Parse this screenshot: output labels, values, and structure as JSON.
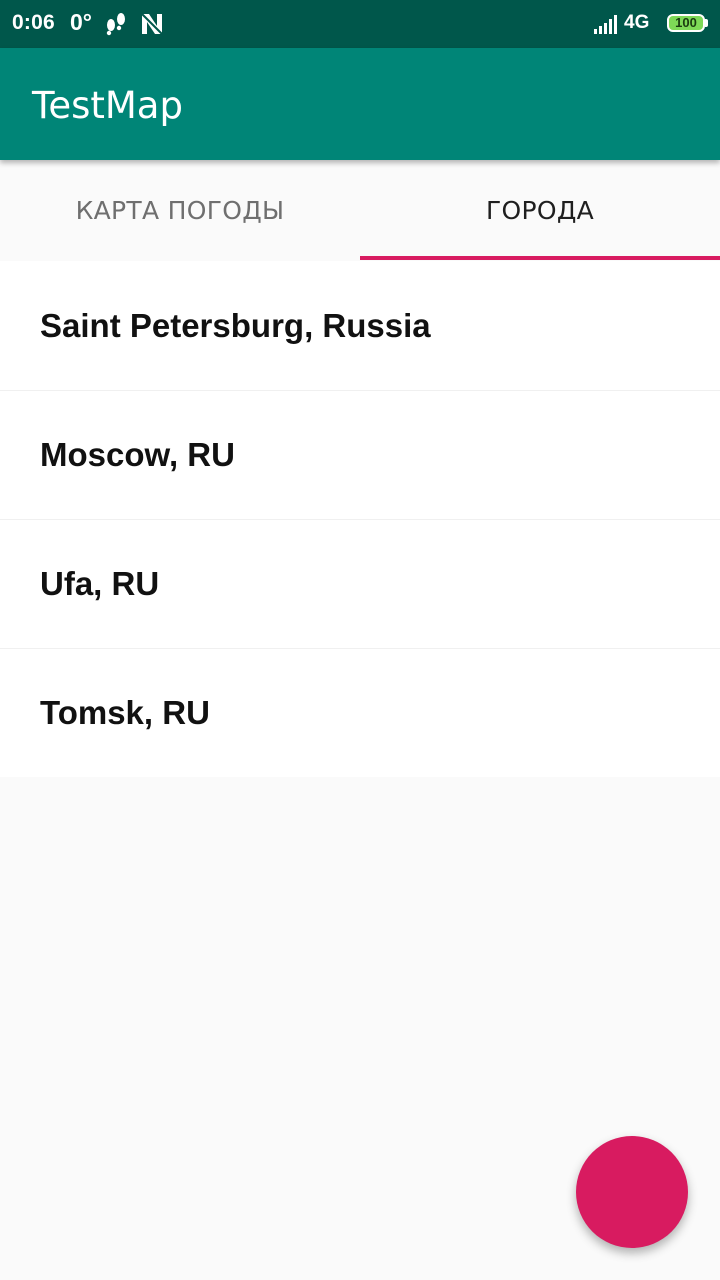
{
  "status_bar": {
    "time": "0:06",
    "temperature": "0°",
    "network": "4G",
    "battery": "100",
    "icons": [
      "footsteps-icon",
      "n-icon",
      "signal-icon",
      "battery-icon"
    ]
  },
  "app_bar": {
    "title": "TestMap",
    "color": "#008577"
  },
  "tabs": [
    {
      "label": "КАРТА ПОГОДЫ",
      "selected": false
    },
    {
      "label": "ГОРОДА",
      "selected": true
    }
  ],
  "cities": [
    {
      "name": "Saint Petersburg, Russia"
    },
    {
      "name": "Moscow, RU"
    },
    {
      "name": "Ufa, RU"
    },
    {
      "name": "Tomsk, RU"
    }
  ],
  "colors": {
    "status_bar": "#00574b",
    "primary": "#008577",
    "accent": "#d81b60"
  },
  "fab": {
    "icon": "none"
  }
}
